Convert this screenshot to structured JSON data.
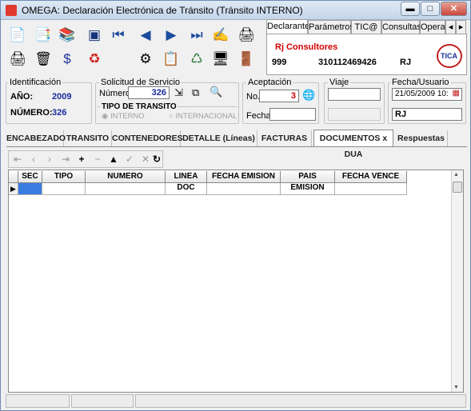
{
  "window": {
    "title": "OMEGA: Declaración Electrónica de Tránsito  (Tránsito INTERNO)"
  },
  "toolbar": {
    "icons": [
      "new-doc-icon",
      "copy-doc-icon",
      "books-icon",
      "select-icon",
      "first-icon",
      "prev-icon",
      "next-icon",
      "last-icon",
      "sign-icon",
      "printer-small-icon",
      "printer-icon",
      "recycle-bin-icon",
      "link-icon",
      "recycle-icon",
      "gear-icon",
      "report-icon",
      "refresh-globe-icon",
      "screen-icon",
      "exit-icon"
    ]
  },
  "top_tabs": [
    "Declarante",
    "Parámetros",
    "TIC@",
    "Consultas",
    "Operac"
  ],
  "declarante": {
    "name": "Rj Consultores",
    "code": "999",
    "nit": "310112469426",
    "initials": "RJ",
    "logo_text": "TICA"
  },
  "identificacion": {
    "label": "Identificación",
    "anio_label": "AÑO:",
    "anio": "2009",
    "numero_label": "NÚMERO:",
    "numero": "326"
  },
  "solicitud": {
    "label": "Solicitud de Servicio",
    "numero_label": "Número:",
    "numero": "326"
  },
  "tipo_transito": {
    "label": "TIPO DE TRANSITO",
    "interno": "INTERNO",
    "internacional": "INTERNACIONAL"
  },
  "aceptacion": {
    "label": "Aceptación",
    "no_label": "No.",
    "no": "3",
    "fecha_label": "Fecha:",
    "fecha": ""
  },
  "viaje": {
    "label": "Viaje",
    "value": ""
  },
  "fecha_usuario": {
    "label": "Fecha/Usuario",
    "fecha": "21/05/2009 10:",
    "usuario": "RJ"
  },
  "mid_tabs": [
    "ENCABEZADO",
    "TRANSITO",
    "CONTENEDORES",
    "DETALLE (Líneas)",
    "FACTURAS",
    "DOCUMENTOS x DUA",
    "Respuestas"
  ],
  "active_tab": "DOCUMENTOS x DUA",
  "grid": {
    "columns": [
      "SEC",
      "TIPO",
      "NUMERO",
      "LINEA DOC",
      "FECHA EMISION",
      "PAIS EMISION",
      "FECHA VENCE"
    ],
    "rows": []
  },
  "colors": {
    "accent_red": "#d20000",
    "number_blue": "#1a2a9a",
    "selected_cell": "#3b7ce0"
  }
}
